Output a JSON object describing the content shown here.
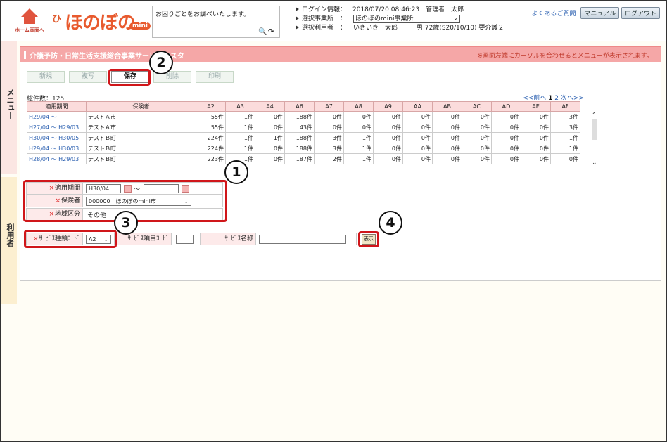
{
  "header": {
    "home_label": "ホーム画面へ",
    "logo_text": "ほのぼの",
    "logo_badge": "mini",
    "help_text": "お困りごとをお調べいたします。",
    "help_search_icon": "search-icon",
    "login_label": "ログイン情報：",
    "login_value": "2018/07/20 08:46:23　管理者　太郎",
    "office_label": "選択事業所　：",
    "office_value": "ほのぼのmini事業所",
    "user_label": "選択利用者　：",
    "user_value": "いきいき　太郎　　　男 72歳(S20/10/10) 要介護２",
    "faq": "よくあるご質問",
    "manual": "マニュアル",
    "logout": "ログアウト"
  },
  "sidetabs": {
    "menu": "メニュー",
    "user": "利用者"
  },
  "title": "介護予防・日常生活支援総合事業サービスマスタ",
  "title_note": "※画面左端にカーソルを合わせるとメニューが表示されます。",
  "toolbar": {
    "new": "新規",
    "copy": "複写",
    "save": "保存",
    "delete": "削除",
    "print": "印刷"
  },
  "total": "総件数：125",
  "pager": {
    "prev": "<<前へ",
    "p1": "1",
    "p2": "2",
    "next": "次へ>>"
  },
  "table": {
    "headers": [
      "適用期間",
      "保険者",
      "A2",
      "A3",
      "A4",
      "A6",
      "A7",
      "A8",
      "A9",
      "AA",
      "AB",
      "AC",
      "AD",
      "AE",
      "AF"
    ],
    "rows": [
      [
        "H29/04 ～",
        "テストＡ市",
        "55件",
        "1件",
        "0件",
        "188件",
        "0件",
        "0件",
        "0件",
        "0件",
        "0件",
        "0件",
        "0件",
        "0件",
        "3件"
      ],
      [
        "H27/04 ～ H29/03",
        "テストＡ市",
        "55件",
        "1件",
        "0件",
        "43件",
        "0件",
        "0件",
        "0件",
        "0件",
        "0件",
        "0件",
        "0件",
        "0件",
        "3件"
      ],
      [
        "H30/04 ～ H30/05",
        "テストＢ町",
        "224件",
        "1件",
        "1件",
        "188件",
        "3件",
        "1件",
        "0件",
        "0件",
        "0件",
        "0件",
        "0件",
        "0件",
        "1件"
      ],
      [
        "H29/04 ～ H30/03",
        "テストＢ町",
        "224件",
        "1件",
        "0件",
        "188件",
        "3件",
        "1件",
        "0件",
        "0件",
        "0件",
        "0件",
        "0件",
        "0件",
        "1件"
      ],
      [
        "H28/04 ～ H29/03",
        "テストＢ町",
        "223件",
        "1件",
        "0件",
        "187件",
        "2件",
        "1件",
        "0件",
        "0件",
        "0件",
        "0件",
        "0件",
        "0件",
        "0件"
      ]
    ]
  },
  "form": {
    "period_label": "適用期間",
    "period_from": "H30/04",
    "period_tilde": "～",
    "period_to": "",
    "insurer_label": "保険者",
    "insurer_value": "000000　ほのぼのmini市",
    "region_label": "地域区分",
    "region_value": "その他",
    "svc_type_label": "ｻｰﾋﾞｽ種類ｺｰﾄﾞ",
    "svc_type_value": "A2",
    "svc_item_label": "ｻｰﾋﾞｽ項目ｺｰﾄﾞ",
    "svc_item_value": "",
    "svc_name_label": "ｻｰﾋﾞｽ名称",
    "svc_name_value": "",
    "show_button": "表示"
  },
  "callouts": [
    "1",
    "2",
    "3",
    "4"
  ],
  "colors": {
    "accent": "#f5a7a7",
    "highlight": "#d0161a",
    "link": "#2a5fb0"
  }
}
